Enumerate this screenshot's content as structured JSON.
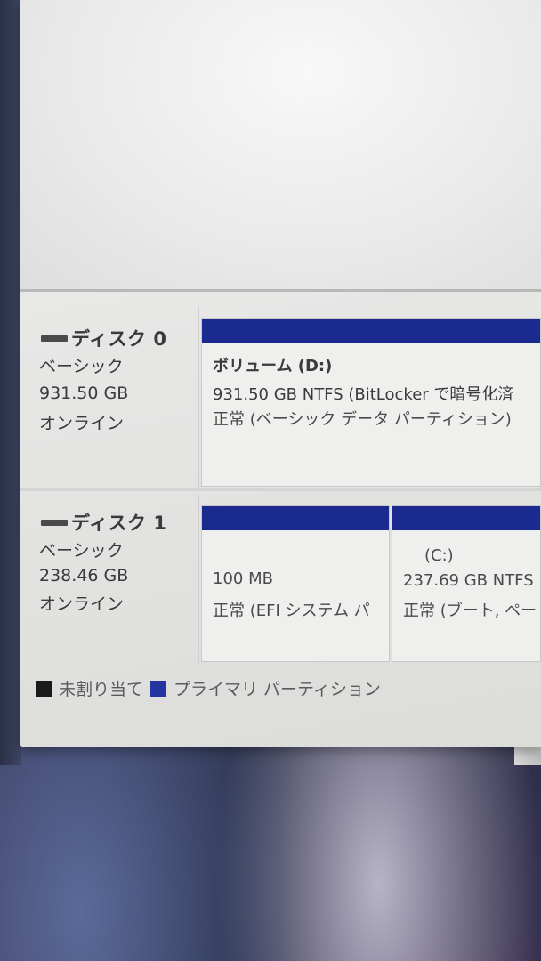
{
  "disks": [
    {
      "name": "ディスク 0",
      "type": "ベーシック",
      "size": "931.50 GB",
      "status": "オンライン",
      "partitions": [
        {
          "label": "ボリューム (D:)",
          "info": "931.50 GB NTFS (BitLocker で暗号化済",
          "state": "正常 (ベーシック データ パーティション)"
        }
      ]
    },
    {
      "name": "ディスク 1",
      "type": "ベーシック",
      "size": "238.46 GB",
      "status": "オンライン",
      "partitions": [
        {
          "label": "",
          "info": "100 MB",
          "state": "正常 (EFI システム パ"
        },
        {
          "label": "(C:)",
          "info": "237.69 GB NTFS",
          "state": "正常 (ブート, ペー"
        }
      ]
    }
  ],
  "legend": {
    "unallocated": "未割り当て",
    "primary": "プライマリ パーティション"
  },
  "colors": {
    "partition_bar": "#1a2a8e",
    "legend_unallocated": "#1a1a1a",
    "legend_primary": "#2434a0"
  }
}
